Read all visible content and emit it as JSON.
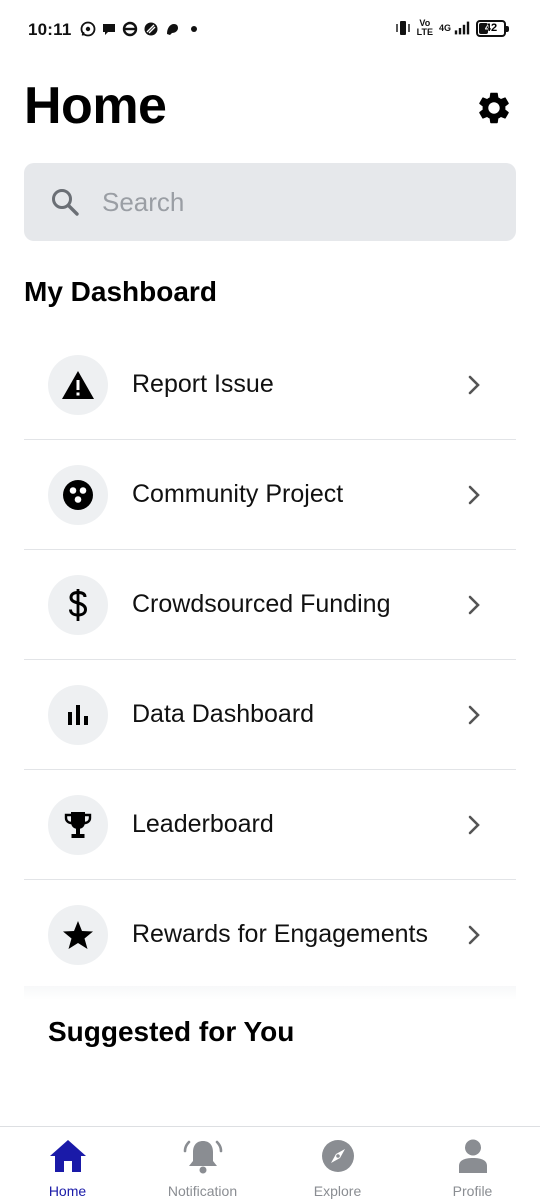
{
  "status_bar": {
    "time": "10:11",
    "network_top": "Vo",
    "network_bottom": "LTE",
    "network_type": "4G",
    "battery_percent": 42,
    "battery_label": "42",
    "left_icons": [
      "whatsapp-icon",
      "chat-bubble-icon",
      "underground-icon",
      "stamp-icon",
      "bird-icon"
    ]
  },
  "header": {
    "title": "Home",
    "settings_icon": "gear-icon"
  },
  "search": {
    "placeholder": "Search",
    "value": ""
  },
  "dashboard": {
    "title": "My Dashboard",
    "items": [
      {
        "label": "Report Issue",
        "icon": "warning-triangle-icon"
      },
      {
        "label": "Community Project",
        "icon": "community-icon"
      },
      {
        "label": "Crowdsourced Funding",
        "icon": "dollar-icon"
      },
      {
        "label": "Data Dashboard",
        "icon": "bar-chart-icon"
      },
      {
        "label": "Leaderboard",
        "icon": "trophy-icon"
      },
      {
        "label": "Rewards for Engagements",
        "icon": "star-icon"
      }
    ]
  },
  "suggested": {
    "title": "Suggested for You"
  },
  "bottom_nav": {
    "items": [
      {
        "label": "Home",
        "icon": "home-icon",
        "active": true
      },
      {
        "label": "Notification",
        "icon": "bell-icon",
        "active": false
      },
      {
        "label": "Explore",
        "icon": "compass-icon",
        "active": false
      },
      {
        "label": "Profile",
        "icon": "person-icon",
        "active": false
      }
    ]
  },
  "colors": {
    "accent": "#1a1aa8",
    "search_bg": "#e6e8eb",
    "icon_circle_bg": "#eef0f2",
    "inactive_nav": "#8a8d92"
  }
}
